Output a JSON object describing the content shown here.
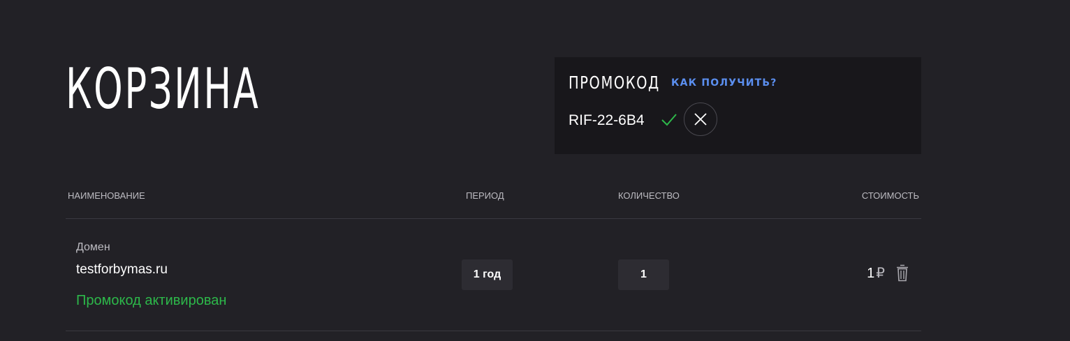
{
  "page_title": "КОРЗИНА",
  "promo": {
    "label": "ПРОМОКОД",
    "help_link": "КАК ПОЛУЧИТЬ?",
    "code": "RIF-22-6B4",
    "check_icon": "check-icon",
    "clear_icon": "close-icon"
  },
  "table": {
    "headers": {
      "name": "НАИМЕНОВАНИЕ",
      "period": "ПЕРИОД",
      "quantity": "КОЛИЧЕСТВО",
      "cost": "СТОИМОСТЬ"
    },
    "rows": [
      {
        "type": "Домен",
        "name": "testforbymas.ru",
        "status": "Промокод активирован",
        "period": "1 год",
        "quantity": "1",
        "price": "1",
        "currency": "₽",
        "delete_icon": "trash-icon"
      }
    ]
  },
  "colors": {
    "background": "#222126",
    "promo_background": "#18171b",
    "accent_link": "#5b8ff0",
    "success": "#2db84a"
  }
}
